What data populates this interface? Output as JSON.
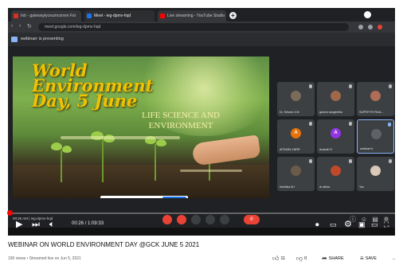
{
  "browser": {
    "tabs": [
      {
        "label": "Inb - gatewaylyceumconvm Fst",
        "color": "#d93025"
      },
      {
        "label": "Meet - ieg-dpmv-hqd",
        "color": "#1a73e8"
      },
      {
        "label": "Live streaming - YouTube Studio",
        "color": "#ff0000"
      }
    ],
    "url": "meet.google.com/ieg-dpmv-hqd"
  },
  "meet": {
    "presenting_text": "webinarr is presenting",
    "slide": {
      "title": "World Environment Day, 5 June",
      "subtitle": "LIFE SCIENCE AND ENVIRONMENT"
    },
    "participants": [
      {
        "name": "Dr. Selvam V.M",
        "initial": "",
        "color": "#7a6b5a"
      },
      {
        "name": "gokum sangeetha",
        "initial": "",
        "color": "#a0674b"
      },
      {
        "name": "SUPRIYTH PAUL...",
        "initial": "",
        "color": "#b06d55"
      },
      {
        "name": "APSARA VNRR",
        "initial": "A",
        "color": "#e8710a"
      },
      {
        "name": "Anandh R",
        "initial": "A",
        "color": "#9334e6"
      },
      {
        "name": "webinarr's",
        "initial": "",
        "color": "#5f6368"
      },
      {
        "name": "Karthika M.I",
        "initial": "",
        "color": "#6b5b4a"
      },
      {
        "name": "dr athira",
        "initial": "",
        "color": "#c0492c"
      },
      {
        "name": "You",
        "initial": "",
        "color": "#d9c7b8"
      }
    ],
    "time": "00:26 AM | ieg-dpmv-hqd"
  },
  "player": {
    "progress": 0.0044,
    "time": "00:26 / 1:09:33"
  },
  "video": {
    "title": "WEBINAR ON WORLD ENVIRONMENT DAY @GCK JUNE 5 2021",
    "meta": "190 views • Streamed live on Jun 5, 2021",
    "likes": "11",
    "dislike": "0",
    "share_label": "SHARE",
    "save_label": "SAVE",
    "more_label": "..."
  },
  "colors": {
    "accent_red": "#ff0000",
    "meet_end": "#ea4335",
    "slide_title": "#f2c200"
  }
}
